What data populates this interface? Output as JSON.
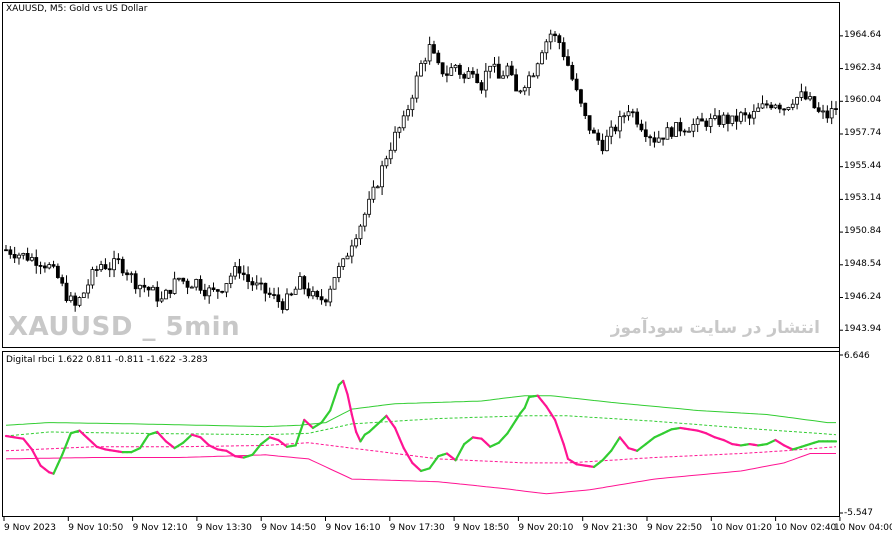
{
  "main_chart": {
    "title": "XAUUSD, M5:  Gold vs US Dollar",
    "watermark_symbol": "XAUUSD _ 5min",
    "watermark_site": "انتشار در سایت سودآموز",
    "price_labels": [
      "1964.64",
      "1962.34",
      "1960.04",
      "1957.74",
      "1955.44",
      "1953.14",
      "1950.84",
      "1948.54",
      "1946.24",
      "1943.94"
    ],
    "price_range": [
      1942.9,
      1966.6
    ],
    "bull_color": "#000000",
    "bear_color": "#000000"
  },
  "indicator": {
    "title": "Digital rbci 1.622 0.811 -0.811 -1.622 -3.283",
    "scale_top": "6.646",
    "scale_bottom": "-5.547",
    "value_range": [
      -5.547,
      6.646
    ],
    "up_color": "#32cd32",
    "down_color": "#ff1493",
    "band_up_color": "#32cd32",
    "band_down_color": "#ff1493"
  },
  "time_axis": {
    "labels": [
      "9 Nov 2023",
      "9 Nov 10:50",
      "9 Nov 12:10",
      "9 Nov 13:30",
      "9 Nov 14:50",
      "9 Nov 16:10",
      "9 Nov 17:30",
      "9 Nov 18:50",
      "9 Nov 20:10",
      "9 Nov 21:30",
      "9 Nov 22:50",
      "10 Nov 01:20",
      "10 Nov 02:40",
      "10 Nov 04:00"
    ]
  },
  "chart_data": {
    "type": "candlestick",
    "symbol": "XAUUSD",
    "timeframe": "M5",
    "close_path": [
      [
        0,
        1949.6
      ],
      [
        4,
        1949.2
      ],
      [
        8,
        1948.8
      ],
      [
        10,
        1948.4
      ],
      [
        12,
        1947.6
      ],
      [
        14,
        1946.4
      ],
      [
        16,
        1945.6
      ],
      [
        18,
        1946.6
      ],
      [
        20,
        1947.8
      ],
      [
        22,
        1948.6
      ],
      [
        24,
        1948.4
      ],
      [
        26,
        1948.7
      ],
      [
        28,
        1948.1
      ],
      [
        30,
        1947.3
      ],
      [
        32,
        1947.0
      ],
      [
        34,
        1946.6
      ],
      [
        36,
        1946.0
      ],
      [
        38,
        1946.9
      ],
      [
        40,
        1947.6
      ],
      [
        42,
        1947.2
      ],
      [
        44,
        1947.4
      ],
      [
        46,
        1946.8
      ],
      [
        48,
        1946.6
      ],
      [
        50,
        1947.0
      ],
      [
        52,
        1947.8
      ],
      [
        54,
        1948.3
      ],
      [
        56,
        1947.4
      ],
      [
        58,
        1947.0
      ],
      [
        60,
        1946.6
      ],
      [
        62,
        1946.2
      ],
      [
        64,
        1945.8
      ],
      [
        66,
        1946.3
      ],
      [
        68,
        1947.3
      ],
      [
        70,
        1946.6
      ],
      [
        72,
        1946.0
      ],
      [
        74,
        1946.3
      ],
      [
        76,
        1947.8
      ],
      [
        78,
        1948.6
      ],
      [
        80,
        1950.2
      ],
      [
        82,
        1951.4
      ],
      [
        84,
        1952.8
      ],
      [
        86,
        1954.4
      ],
      [
        88,
        1956.2
      ],
      [
        90,
        1957.6
      ],
      [
        92,
        1958.6
      ],
      [
        94,
        1960.6
      ],
      [
        96,
        1962.6
      ],
      [
        98,
        1963.8
      ],
      [
        100,
        1962.4
      ],
      [
        102,
        1962.0
      ],
      [
        104,
        1962.6
      ],
      [
        106,
        1961.6
      ],
      [
        108,
        1962.4
      ],
      [
        110,
        1961.2
      ],
      [
        112,
        1962.8
      ],
      [
        114,
        1961.6
      ],
      [
        116,
        1962.4
      ],
      [
        118,
        1960.6
      ],
      [
        120,
        1961.4
      ],
      [
        122,
        1962.2
      ],
      [
        124,
        1963.8
      ],
      [
        126,
        1964.8
      ],
      [
        128,
        1964.2
      ],
      [
        130,
        1962.6
      ],
      [
        132,
        1960.6
      ],
      [
        134,
        1958.8
      ],
      [
        136,
        1957.6
      ],
      [
        138,
        1957.0
      ],
      [
        140,
        1957.8
      ],
      [
        142,
        1958.6
      ],
      [
        144,
        1959.6
      ],
      [
        146,
        1958.8
      ],
      [
        148,
        1958.0
      ],
      [
        150,
        1957.4
      ],
      [
        152,
        1957.7
      ],
      [
        154,
        1958.0
      ],
      [
        156,
        1958.2
      ],
      [
        158,
        1958.3
      ],
      [
        160,
        1958.4
      ],
      [
        162,
        1958.6
      ],
      [
        164,
        1958.6
      ],
      [
        166,
        1958.8
      ],
      [
        168,
        1958.6
      ],
      [
        170,
        1959.0
      ],
      [
        172,
        1958.8
      ],
      [
        174,
        1959.4
      ],
      [
        176,
        1959.8
      ],
      [
        178,
        1960.0
      ],
      [
        180,
        1959.6
      ],
      [
        182,
        1960.2
      ],
      [
        184,
        1960.4
      ],
      [
        186,
        1960.0
      ],
      [
        188,
        1959.2
      ],
      [
        190,
        1959.0
      ],
      [
        192,
        1959.6
      ]
    ],
    "rbci_path": [
      [
        0,
        0.4
      ],
      [
        4,
        0.2
      ],
      [
        6,
        -0.6
      ],
      [
        8,
        -1.8
      ],
      [
        10,
        -2.3
      ],
      [
        11,
        -2.4
      ],
      [
        13,
        -1.0
      ],
      [
        15,
        0.6
      ],
      [
        17,
        0.8
      ],
      [
        19,
        0.2
      ],
      [
        21,
        -0.4
      ],
      [
        23,
        -0.6
      ],
      [
        25,
        -0.7
      ],
      [
        27,
        -0.8
      ],
      [
        29,
        -0.8
      ],
      [
        31,
        -0.5
      ],
      [
        33,
        0.5
      ],
      [
        35,
        0.7
      ],
      [
        37,
        0.0
      ],
      [
        39,
        -0.5
      ],
      [
        41,
        -0.1
      ],
      [
        43,
        0.5
      ],
      [
        45,
        0.3
      ],
      [
        47,
        -0.3
      ],
      [
        49,
        -0.6
      ],
      [
        51,
        -0.7
      ],
      [
        53,
        -1.1
      ],
      [
        55,
        -1.2
      ],
      [
        57,
        -1.0
      ],
      [
        59,
        -0.2
      ],
      [
        61,
        0.3
      ],
      [
        63,
        0.1
      ],
      [
        65,
        -0.4
      ],
      [
        67,
        -0.3
      ],
      [
        69,
        1.6
      ],
      [
        71,
        1.0
      ],
      [
        73,
        1.4
      ],
      [
        75,
        2.3
      ],
      [
        77,
        4.2
      ],
      [
        78,
        4.5
      ],
      [
        79,
        3.5
      ],
      [
        80,
        2.0
      ],
      [
        81,
        0.7
      ],
      [
        82,
        0.0
      ],
      [
        83,
        0.5
      ],
      [
        84,
        0.7
      ],
      [
        86,
        1.3
      ],
      [
        88,
        1.9
      ],
      [
        90,
        1.0
      ],
      [
        92,
        -0.5
      ],
      [
        94,
        -1.6
      ],
      [
        96,
        -2.2
      ],
      [
        98,
        -2.0
      ],
      [
        100,
        -1.1
      ],
      [
        102,
        -0.9
      ],
      [
        104,
        -1.4
      ],
      [
        106,
        -0.2
      ],
      [
        108,
        0.3
      ],
      [
        110,
        0.2
      ],
      [
        112,
        -0.4
      ],
      [
        114,
        -0.1
      ],
      [
        116,
        0.6
      ],
      [
        118,
        1.6
      ],
      [
        119,
        2.1
      ],
      [
        120,
        2.5
      ],
      [
        121,
        3.3
      ],
      [
        123,
        3.4
      ],
      [
        125,
        2.6
      ],
      [
        127,
        1.6
      ],
      [
        129,
        -0.2
      ],
      [
        130,
        -1.3
      ],
      [
        132,
        -1.7
      ],
      [
        134,
        -1.8
      ],
      [
        136,
        -1.9
      ],
      [
        138,
        -1.4
      ],
      [
        140,
        -0.7
      ],
      [
        142,
        0.3
      ],
      [
        144,
        -0.5
      ],
      [
        146,
        -0.7
      ],
      [
        148,
        -0.2
      ],
      [
        150,
        0.3
      ],
      [
        152,
        0.6
      ],
      [
        154,
        0.9
      ],
      [
        156,
        1.0
      ],
      [
        158,
        0.9
      ],
      [
        160,
        0.8
      ],
      [
        162,
        0.6
      ],
      [
        164,
        0.3
      ],
      [
        166,
        0.1
      ],
      [
        168,
        -0.2
      ],
      [
        170,
        -0.3
      ],
      [
        172,
        -0.2
      ],
      [
        174,
        -0.3
      ],
      [
        176,
        -0.2
      ],
      [
        178,
        0.1
      ],
      [
        180,
        -0.3
      ],
      [
        182,
        -0.6
      ],
      [
        184,
        -0.4
      ],
      [
        186,
        -0.2
      ],
      [
        188,
        0.0
      ]
    ],
    "band_upper_solid": [
      [
        0,
        1.2
      ],
      [
        10,
        1.4
      ],
      [
        30,
        1.3
      ],
      [
        60,
        1.1
      ],
      [
        68,
        1.2
      ],
      [
        74,
        1.4
      ],
      [
        80,
        2.4
      ],
      [
        90,
        2.8
      ],
      [
        110,
        3.0
      ],
      [
        120,
        3.4
      ],
      [
        126,
        3.4
      ],
      [
        140,
        2.9
      ],
      [
        160,
        2.3
      ],
      [
        176,
        2.0
      ],
      [
        190,
        1.4
      ],
      [
        192,
        1.4
      ]
    ],
    "band_upper_dashed": [
      [
        0,
        0.4
      ],
      [
        10,
        0.7
      ],
      [
        30,
        0.6
      ],
      [
        60,
        0.5
      ],
      [
        70,
        0.6
      ],
      [
        80,
        1.3
      ],
      [
        100,
        1.7
      ],
      [
        120,
        1.9
      ],
      [
        130,
        1.9
      ],
      [
        150,
        1.5
      ],
      [
        170,
        1.0
      ],
      [
        192,
        0.5
      ]
    ],
    "band_lower_dashed": [
      [
        0,
        -0.7
      ],
      [
        20,
        -0.4
      ],
      [
        40,
        -0.4
      ],
      [
        60,
        -0.3
      ],
      [
        70,
        -0.1
      ],
      [
        80,
        -0.5
      ],
      [
        100,
        -1.3
      ],
      [
        120,
        -1.6
      ],
      [
        130,
        -1.6
      ],
      [
        150,
        -1.2
      ],
      [
        170,
        -0.9
      ],
      [
        180,
        -0.7
      ],
      [
        192,
        -0.4
      ]
    ],
    "band_lower_solid": [
      [
        0,
        -1.3
      ],
      [
        20,
        -1.2
      ],
      [
        40,
        -1.2
      ],
      [
        60,
        -1.0
      ],
      [
        70,
        -1.3
      ],
      [
        80,
        -2.8
      ],
      [
        100,
        -3.0
      ],
      [
        115,
        -3.5
      ],
      [
        125,
        -3.9
      ],
      [
        135,
        -3.6
      ],
      [
        150,
        -2.8
      ],
      [
        170,
        -2.2
      ],
      [
        180,
        -1.6
      ],
      [
        186,
        -0.9
      ],
      [
        192,
        -0.9
      ]
    ]
  }
}
